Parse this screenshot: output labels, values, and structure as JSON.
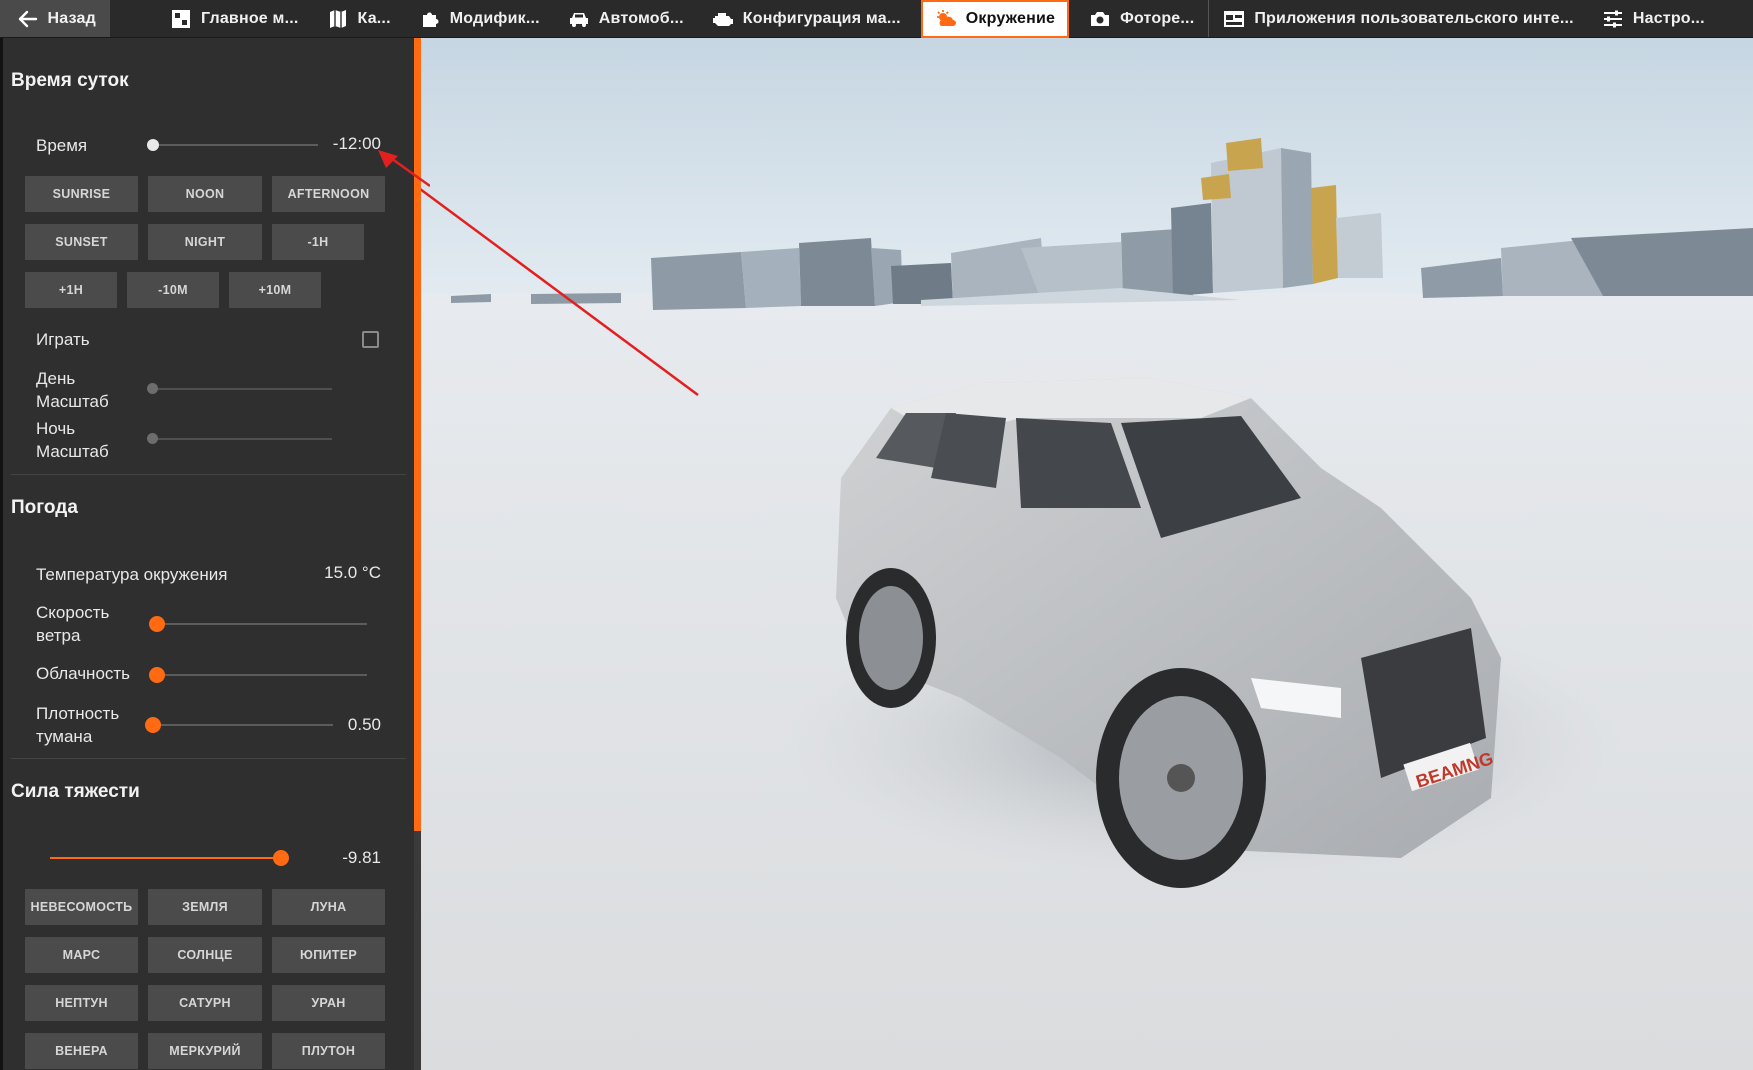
{
  "topbar": {
    "tabs": [
      {
        "label": "Назад",
        "icon": "arrow-left-icon"
      },
      {
        "label": "Главное м...",
        "icon": "home-map-icon"
      },
      {
        "label": "Ка...",
        "icon": "map-icon"
      },
      {
        "label": "Модифик...",
        "icon": "puzzle-icon"
      },
      {
        "label": "Автомоб...",
        "icon": "car-icon"
      },
      {
        "label": "Конфигурация ма...",
        "icon": "engine-icon"
      },
      {
        "label": "Окружение",
        "icon": "weather-icon"
      },
      {
        "label": "Фоторе...",
        "icon": "camera-icon"
      },
      {
        "label": "Приложения пользовательского инте...",
        "icon": "apps-icon"
      },
      {
        "label": "Настро...",
        "icon": "sliders-icon"
      }
    ],
    "active_tab": "Окружение",
    "accent_color": "#ff6a13"
  },
  "time_of_day": {
    "title": "Время суток",
    "time_label": "Время",
    "time_value": "-12:00",
    "time_buttons": [
      "SUNRISE",
      "NOON",
      "AFTERNOON",
      "SUNSET",
      "NIGHT",
      "-1H",
      "+1H",
      "-10M",
      "+10M"
    ],
    "play_label": "Играть",
    "play_checked": false,
    "day_scale_label": [
      "День",
      "Масштаб"
    ],
    "night_scale_label": [
      "Ночь",
      "Масштаб"
    ]
  },
  "weather": {
    "title": "Погода",
    "temperature_label": "Температура окружения",
    "temperature_value": "15.0 °C",
    "wind_label": [
      "Скорость",
      "ветра"
    ],
    "clouds_label": "Облачность",
    "fog_label": [
      "Плотность",
      "тумана"
    ],
    "fog_value": "0.50"
  },
  "gravity": {
    "title": "Сила тяжести",
    "value": "-9.81",
    "buttons": [
      "НЕВЕСОМОСТЬ",
      "ЗЕМЛЯ",
      "ЛУНА",
      "МАРС",
      "СОЛНЦЕ",
      "ЮПИТЕР",
      "НЕПТУН",
      "САТУРН",
      "УРАН",
      "ВЕНЕРА",
      "МЕРКУРИЙ",
      "ПЛУТОН"
    ]
  },
  "viewport": {
    "license_plate": "BEAMNG"
  }
}
